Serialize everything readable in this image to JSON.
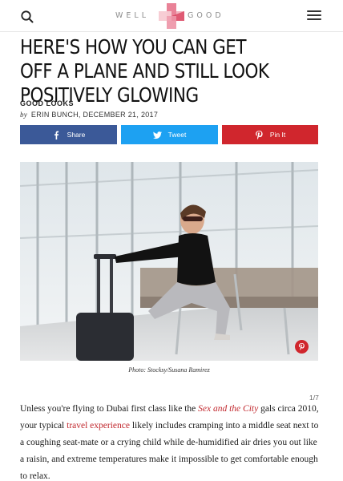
{
  "header": {
    "logo_left": "WELL",
    "logo_right": "GOOD",
    "search_icon": "search-icon",
    "menu_icon": "hamburger-menu-icon"
  },
  "article": {
    "title": "HERE'S HOW YOU CAN GET OFF A PLANE AND STILL LOOK POSITIVELY GLOWING",
    "category": "GOOD LOOKS",
    "byline_prefix": "by",
    "author_date": "ERIN BUNCH, DECEMBER 21, 2017"
  },
  "share": {
    "facebook": "Share",
    "twitter": "Tweet",
    "pinterest": "Pin It"
  },
  "image": {
    "caption": "Photo: Stocksy/Susana Ramirez",
    "counter": "1/7"
  },
  "body": {
    "p1_a": "Unless you're flying to Dubai first class like the ",
    "p1_link1": "Sex and the City",
    "p1_b": " gals circa 2010, your typical ",
    "p1_link2": "travel experience",
    "p1_c": " likely includes cramping into a middle seat next to a coughing seat-mate or a crying child while de-humidified air dries you out like a raisin, and extreme temperatures make it impossible to get comfortable enough to relax."
  },
  "colors": {
    "facebook": "#3b5998",
    "twitter": "#1da1f2",
    "pinterest": "#d0262d",
    "link": "#c1272d"
  }
}
